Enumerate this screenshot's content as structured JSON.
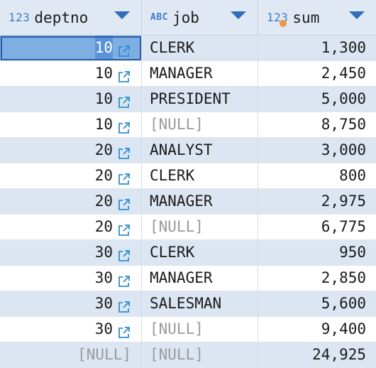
{
  "columns": [
    {
      "type_label": "123",
      "name": "deptno"
    },
    {
      "type_label": "ABC",
      "name": "job"
    },
    {
      "type_label": "123",
      "name": "sum"
    }
  ],
  "rows": [
    {
      "deptno": "10",
      "job": "CLERK",
      "sum": "1,300"
    },
    {
      "deptno": "10",
      "job": "MANAGER",
      "sum": "2,450"
    },
    {
      "deptno": "10",
      "job": "PRESIDENT",
      "sum": "5,000"
    },
    {
      "deptno": "10",
      "job": "[NULL]",
      "sum": "8,750"
    },
    {
      "deptno": "20",
      "job": "ANALYST",
      "sum": "3,000"
    },
    {
      "deptno": "20",
      "job": "CLERK",
      "sum": "800"
    },
    {
      "deptno": "20",
      "job": "MANAGER",
      "sum": "2,975"
    },
    {
      "deptno": "20",
      "job": "[NULL]",
      "sum": "6,775"
    },
    {
      "deptno": "30",
      "job": "CLERK",
      "sum": "950"
    },
    {
      "deptno": "30",
      "job": "MANAGER",
      "sum": "2,850"
    },
    {
      "deptno": "30",
      "job": "SALESMAN",
      "sum": "5,600"
    },
    {
      "deptno": "30",
      "job": "[NULL]",
      "sum": "9,400"
    },
    {
      "deptno": "[NULL]",
      "job": "[NULL]",
      "sum": "24,925"
    }
  ],
  "null_text": "[NULL]",
  "icons": {
    "column_sort": "triangle-down-icon",
    "foreign_key_link": "external-link-icon"
  },
  "colors": {
    "header_bg": "#dfe8f3",
    "alt_row_bg": "#dce6f2",
    "selected_bg": "#7faee3",
    "accent": "#2f6fb8",
    "null_text": "#9a9a9a"
  }
}
